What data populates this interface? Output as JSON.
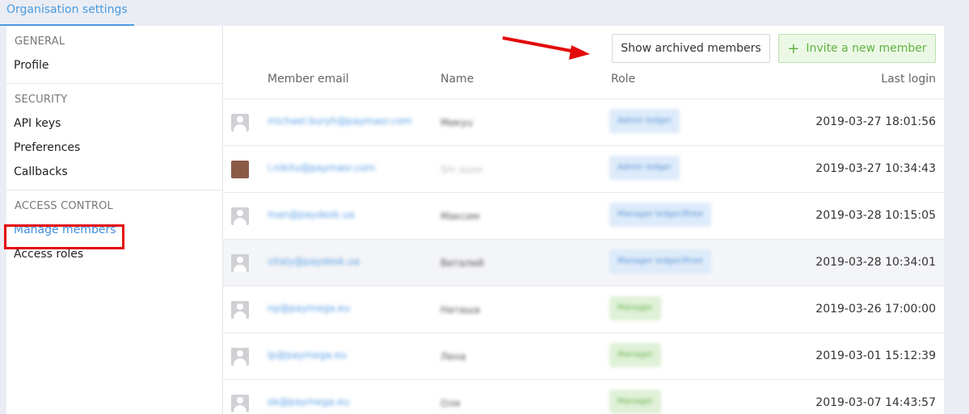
{
  "top_tab": {
    "label": "Organisation settings"
  },
  "sidebar": {
    "sections": [
      {
        "heading": "GENERAL",
        "items": [
          "Profile"
        ]
      },
      {
        "heading": "SECURITY",
        "items": [
          "API keys",
          "Preferences",
          "Callbacks"
        ]
      },
      {
        "heading": "ACCESS CONTROL",
        "items": [
          "Manage members",
          "Access roles"
        ]
      }
    ],
    "active_item": "Manage members"
  },
  "toolbar": {
    "show_archived_label": "Show archived members",
    "invite_label": "Invite a new member"
  },
  "table": {
    "columns": {
      "email": "Member email",
      "name": "Name",
      "role": "Role",
      "last_login": "Last login"
    },
    "rows": [
      {
        "email": "michael.buryh@paymasr.com",
        "name": "Микyu",
        "role": "Admin ledger",
        "last_login": "2019-03-27 18:01:56"
      },
      {
        "email": "l.nikitu@paymasr.com",
        "name": "Sm auxx",
        "role": "Admin ledger",
        "last_login": "2019-03-27 10:34:43"
      },
      {
        "email": "man@paydesk.ua",
        "name": "Максим",
        "role": "Manager ledger/ftree",
        "last_login": "2019-03-28 10:15:05"
      },
      {
        "email": "vitaly@paydesk.ua",
        "name": "Виталий",
        "role": "Manager ledger/ftree",
        "last_login": "2019-03-28 10:34:01"
      },
      {
        "email": "np@paymega.eu",
        "name": "Наташа",
        "role": "Manager",
        "last_login": "2019-03-26 17:00:00"
      },
      {
        "email": "lp@paymega.eu",
        "name": "Лена",
        "role": "Manager",
        "last_login": "2019-03-01 15:12:39"
      },
      {
        "email": "ok@paymega.eu",
        "name": "Оля",
        "role": "Manager",
        "last_login": "2019-03-07 14:43:57"
      }
    ]
  },
  "colors": {
    "accent": "#4a9be0",
    "annotation": "#e30a0a",
    "invite": "#5eb33f"
  }
}
